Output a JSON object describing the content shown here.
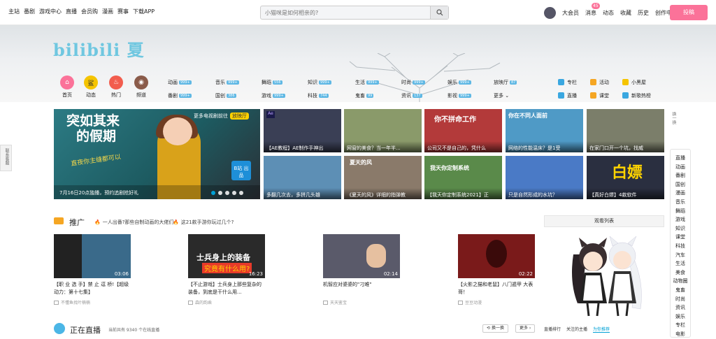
{
  "topbar": {
    "nav_left": [
      "主站",
      "番剧",
      "游戏中心",
      "直播",
      "会员购",
      "漫画",
      "赛事",
      "下载APP"
    ],
    "search_placeholder": "小猫咪是如何相亲的?",
    "nav_right": [
      "大会员",
      "消息",
      "动态",
      "收藏",
      "历史",
      "创作中心"
    ],
    "message_count": "45",
    "upload_label": "投稿"
  },
  "banner": {
    "logo_text": "bilibili 夏"
  },
  "side_tab": "联系客服",
  "quick_links": [
    {
      "label": "首页",
      "icon": "home-icon",
      "color": "#fb7299"
    },
    {
      "label": "动态",
      "icon": "dynamic-icon",
      "color": "#f5c400"
    },
    {
      "label": "热门",
      "icon": "hot-icon",
      "color": "#f25d4e"
    },
    {
      "label": "频道",
      "icon": "channel-icon",
      "color": "#8a5b4a"
    }
  ],
  "categories": [
    {
      "label": "动画",
      "count": "999+"
    },
    {
      "label": "音乐",
      "count": "999+"
    },
    {
      "label": "舞蹈",
      "count": "556"
    },
    {
      "label": "知识",
      "count": "999+"
    },
    {
      "label": "生活",
      "count": "999+"
    },
    {
      "label": "时尚",
      "count": "999+"
    },
    {
      "label": "娱乐",
      "count": "999+"
    },
    {
      "label": "放映厅",
      "count": "87"
    },
    {
      "label": "番剧",
      "count": "999+"
    },
    {
      "label": "国创",
      "count": "386"
    },
    {
      "label": "游戏",
      "count": "999+"
    },
    {
      "label": "科技",
      "count": "744"
    },
    {
      "label": "鬼畜",
      "count": "99"
    },
    {
      "label": "资讯",
      "count": "137"
    },
    {
      "label": "影视",
      "count": "999+"
    },
    {
      "label": "更多",
      "count": ""
    }
  ],
  "extras": [
    {
      "label": "专栏",
      "color": "#3aa7e0"
    },
    {
      "label": "活动",
      "color": "#f5a623"
    },
    {
      "label": "小黑屋",
      "color": "#f5c400"
    },
    {
      "label": "直播",
      "color": "#3aa7e0"
    },
    {
      "label": "课堂",
      "color": "#f5a623"
    },
    {
      "label": "新歌热榜",
      "color": "#3aa7e0"
    }
  ],
  "carousel": {
    "title_line1": "突如其来",
    "title_line2": "的假期",
    "subtitle": "直夜你主缝都可以",
    "promo_text": "更多电视剧前往",
    "promo_badge": "放映厅",
    "caption": "7月16日20点独播，预约追剧抢好礼",
    "logo_text": "B站 出品"
  },
  "featured": [
    {
      "caption": "【AE教程】AE制作手神出",
      "big": "",
      "bg": "#3a3f55"
    },
    {
      "caption": "网窗的美食？当一年半...",
      "big": "",
      "bg": "#8a9a6a"
    },
    {
      "caption": "公司又不是自己的，凭什么",
      "big": "你不拼命工作",
      "bg": "#b33a3a"
    },
    {
      "caption": "网络的性能温床？是1受",
      "big": "你在不同人面前",
      "bg": "#4f9ac6"
    },
    {
      "caption": "在家门口开一个坑，找威",
      "big": "",
      "bg": "#7b7e6a"
    },
    {
      "caption": "多翻几次去，多拼几头雄",
      "big": "",
      "bg": "#5d8fb5"
    },
    {
      "caption": "《夏天的风》详细的指弹教",
      "big": "夏天的风",
      "bg": "#8a7a6a"
    },
    {
      "caption": "【我天你定制系统2021】正",
      "big": "我天你定制系统",
      "bg": "#5a8a4a"
    },
    {
      "caption": "只是自然形成的水坑？",
      "big": "",
      "bg": "#4a7ac6"
    },
    {
      "caption": "【真好白嫖】4款软件",
      "big": "白嫖",
      "bg": "#2a2f40"
    }
  ],
  "refresh_label": "换一换",
  "side_nav": [
    "直播",
    "动画",
    "番剧",
    "国创",
    "漫画",
    "音乐",
    "舞蹈",
    "游戏",
    "知识",
    "课堂",
    "科技",
    "汽车",
    "生活",
    "美食",
    "动物圈",
    "鬼畜",
    "时尚",
    "资讯",
    "娱乐",
    "专栏",
    "电影"
  ],
  "promo": {
    "title": "推广",
    "headlines": [
      "一人出番?那些自制动画的大佬们",
      "这21款手游你玩过几个?"
    ],
    "watch_list": "观看列表",
    "cards": [
      {
        "title": "【职 业 选 手】禁 止 逗 桥!【超级动力：第十七集】",
        "uploader": "不懂鱼找叶楠楠",
        "duration": "03:06",
        "bg": "#3a6a8a"
      },
      {
        "title": "【不止游戏】士兵身上那些复杂的装备，到底是干什么用...",
        "uploader": "森的韵乘",
        "duration": "16:23",
        "bg": "#2a2a2a",
        "overlay_line1": "士兵身上的装备",
        "overlay_line2": "究竟有什么用?"
      },
      {
        "title": "机智应对婆婆的\"刁难\"",
        "uploader": "天天鉴宝",
        "duration": "02:14",
        "bg": "#5a5a6a"
      },
      {
        "title": "【火影之猫和老鼠】八门遁甲 大表哥！",
        "uploader": "豆豆动漫",
        "duration": "02:22",
        "bg": "#7a1a1a"
      }
    ]
  },
  "live": {
    "title": "正在直播",
    "subtitle": "当前共有 9340 个在线直播",
    "refresh_label": "换一换",
    "more_label": "更多",
    "tabs": [
      "直播排行",
      "关注的主播",
      "为你推荐"
    ]
  }
}
